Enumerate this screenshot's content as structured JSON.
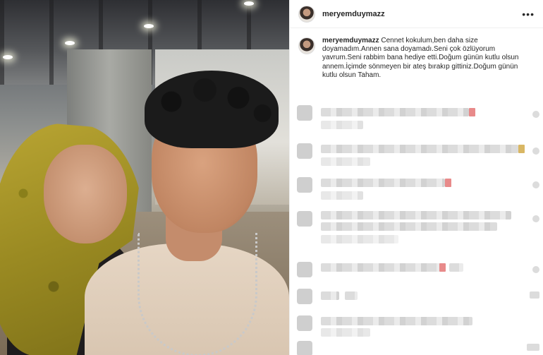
{
  "post": {
    "username": "meryemduymazz",
    "caption_user": "meryemduymazz",
    "caption": " Cennet kokulum,ben daha size doyamadım.Annen sana doyamadı.Seni çok özlüyorum yavrum.Seni rabbim bana hediye etti.Doğum günün kutlu olsun annem.İçimde sönmeyen bir ateş bırakıp gittiniz.Doğum günün kutlu olsun Taham.",
    "more_icon": "more-icon"
  },
  "colors": {
    "accent_pink": "#e88a8a",
    "accent_gold": "#d9b764"
  }
}
